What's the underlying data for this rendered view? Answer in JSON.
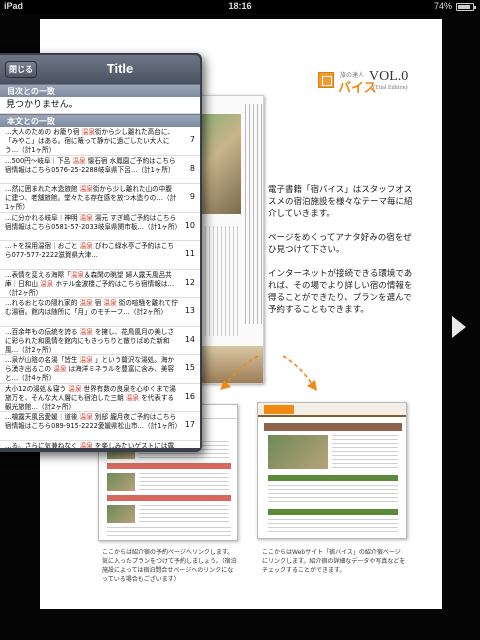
{
  "status": {
    "time": "18:16",
    "battery": "74%",
    "battery_level": 0.74
  },
  "colors": {
    "keyword": "#d43a2a",
    "accent": "#f08a14"
  },
  "popover": {
    "close_label": "閉じる",
    "title": "Title",
    "section_toc": "目次との一致",
    "not_found": "見つかりません。",
    "section_body": "本文との一致",
    "results": [
      {
        "before": "…大人のための お籠り宿 ",
        "keyword": "温泉",
        "after": "街から少し離れた高台に、「みやこ」はある。宿に篭って静かに過ごしたい大人にう…（計1ヶ所）",
        "num": "7"
      },
      {
        "before": "…500円〜岐阜｜下呂 ",
        "keyword": "温泉",
        "after": " 懐石宿 水鳳園ご予約はこちら宿情報はこちら0576-25-2288岐阜県下呂…（計1ヶ所）",
        "num": "8"
      },
      {
        "before": "…然に囲まれた木造旅館 ",
        "keyword": "温泉",
        "after": "街から少し離れた山の中腹に建つ、老舗旅館。堂々たる存在感を放つ木造りの…（計1ヶ所）",
        "num": "9"
      },
      {
        "before": "…に分かれる岐阜｜神明 ",
        "keyword": "温泉",
        "after": " 湯元 すぎ嶋ご予約はこちら宿情報はこちら0581-57-2033岐阜県関市板…（計1ヶ所）",
        "num": "10"
      },
      {
        "before": "…トを採用温宿｜おごと ",
        "keyword": "温泉",
        "after": " びわこ緑水亭ご予約はこちら077-577-2222滋賀県大津…",
        "num": "11"
      },
      {
        "before": "…表情を変える海際「",
        "keyword": "温泉",
        "after": "＆森閑の眺望 婦人露天風呂共庫｜日和山 ",
        "keyword2": "温泉",
        "after2": " ホテル金波楼ご予約はこちら宿情報は…（計2ヶ所）",
        "num": "12"
      },
      {
        "before": "…れるおとなの隠れ家的 ",
        "keyword": "温泉",
        "after": " 宿 ",
        "keyword2": "温泉",
        "after2": " 街の喧騒を離れて佇む湯宿。館内は随所に「月」のモチーフ…（計2ヶ所）",
        "num": "13"
      },
      {
        "before": "…百余年もの伝統を誇る ",
        "keyword": "温泉",
        "after": " を擁し、花鳥風月の美しさに彩られた和風情を館内にもきっちりと散りばめた新和風…（計2ヶ所）",
        "num": "14"
      },
      {
        "before": "…泉が山陰の名湯「皆生 ",
        "keyword": "温泉",
        "after": " 」という贅沢な湯処。海から湧き出るこの ",
        "keyword2": "温泉",
        "after2": " は海洋ミネラルを豊富に含み、美容と…（計4ヶ所）",
        "num": "15"
      },
      {
        "before": "大小12の湯処＆寝う ",
        "keyword": "温泉",
        "after": " 世界有数の良泉を心ゆくまで湯旅万を、そんな大人層にも宿泊した三朝 ",
        "keyword2": "温泉",
        "after2": " を代表する観光旅館…（計2ヶ所）",
        "num": "16"
      },
      {
        "before": "…檜露天風呂愛媛｜道後 ",
        "keyword": "温泉",
        "after": " 別邸 朧月夜ご予約はこちら宿情報はこちら089-915-2222愛媛県松山市…（計1ヶ所）",
        "num": "17"
      },
      {
        "before": "…る。さらに気兼ねなく ",
        "keyword": "温泉",
        "after": " を楽しみたいゲストには露天風呂付き客室「松風権」がおすすめ。それそ",
        "num": "18"
      }
    ]
  },
  "logo": {
    "small": "旅の達人",
    "name": "バイス",
    "vol": "VOL.0",
    "edition": "(Trial Edition)"
  },
  "intro": [
    "電子書籍「宿バイス」はスタッフオススメの宿泊施設を様々なテーマ毎に紹介していきます。",
    "ページをめくってアナタ好みの宿をぜひ見つけて下さい。",
    "インターネットが接続できる環境であれば、その場でより詳しい宿の情報を得ることができたり、プランを選んで予約することもできます。"
  ],
  "captions": {
    "left": "ここからは紹介宿の予約ページへリンクします。気に入ったプランをつけて予約しましょう。（宿泊施設によっては宿泊問合せページへのリンクになっている場合もございます）",
    "right": "ここからはWebサイト「宿バイス」の紹介宿ページにリンクします。紹介宿の詳細なデータや写真などをチェックすることができます。"
  }
}
